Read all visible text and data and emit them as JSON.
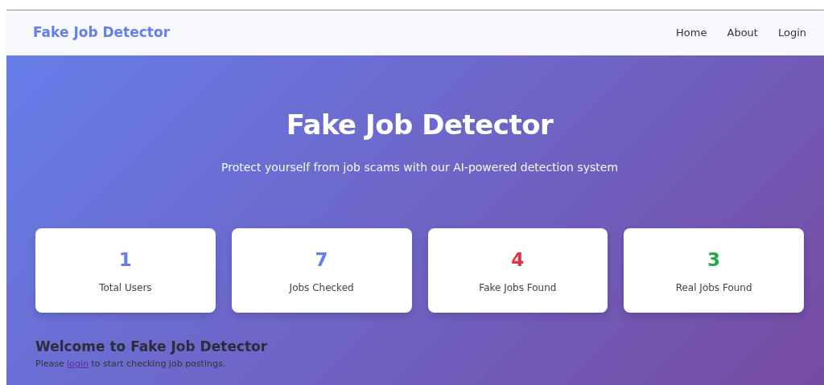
{
  "navbar": {
    "brand": "Fake Job Detector",
    "links": [
      "Home",
      "About",
      "Login"
    ]
  },
  "hero": {
    "title": "Fake Job Detector",
    "subtitle": "Protect yourself from job scams with our AI-powered detection system"
  },
  "stats": [
    {
      "value": "1",
      "label": "Total Users",
      "color": "#667eea"
    },
    {
      "value": "7",
      "label": "Jobs Checked",
      "color": "#667eea"
    },
    {
      "value": "4",
      "label": "Fake Jobs Found",
      "color": "#dc3545"
    },
    {
      "value": "3",
      "label": "Real Jobs Found",
      "color": "#28a745"
    }
  ],
  "welcome": {
    "heading": "Welcome to Fake Job Detector",
    "text_before": "Please ",
    "link": "login",
    "text_after": " to start checking job postings."
  }
}
